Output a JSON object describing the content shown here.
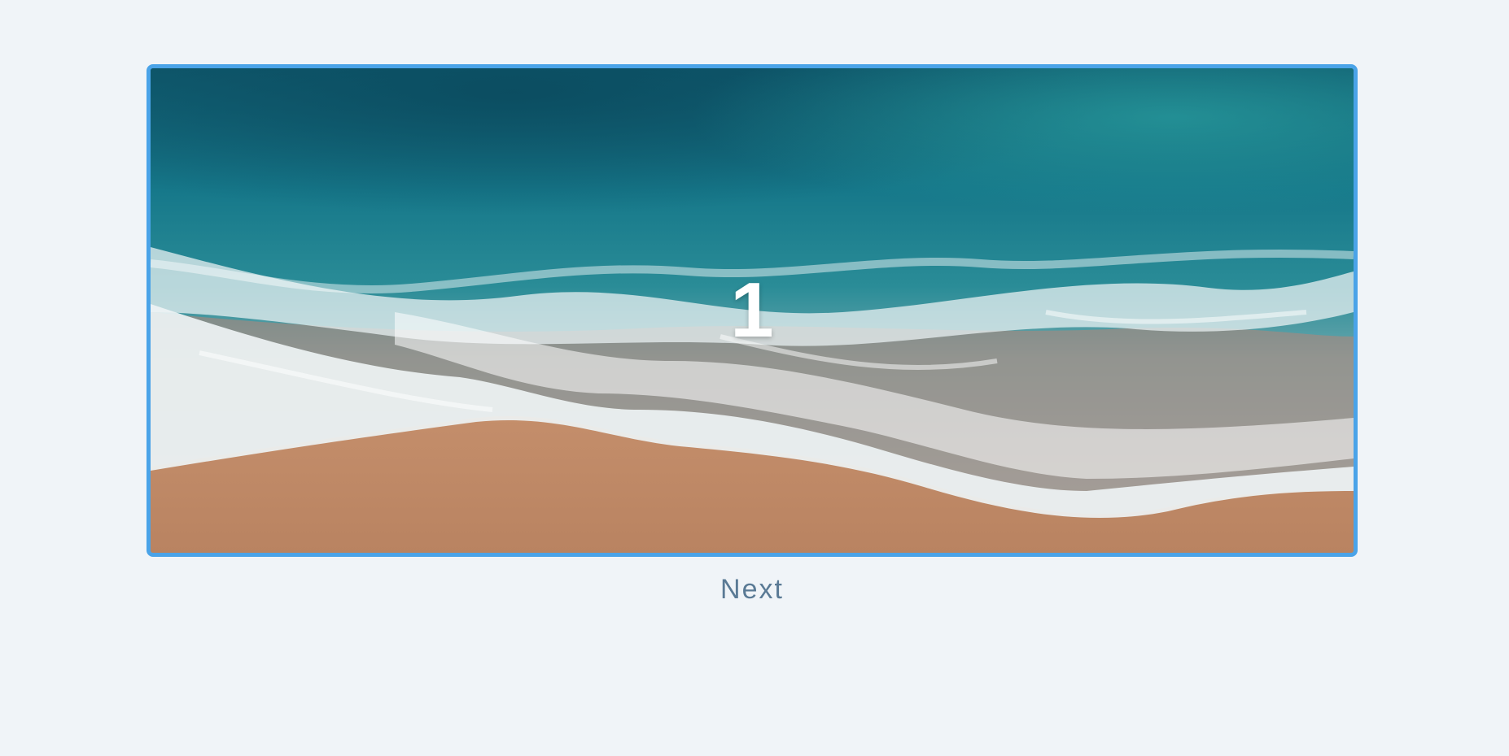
{
  "slideshow": {
    "current_slide_number": "1",
    "slide_image_subject": "beach-waves-aerial-photo",
    "frame_border_color": "#4aa3e8",
    "next_label": "Next"
  },
  "colors": {
    "background": "#f0f4f8",
    "accent": "#4aa3e8",
    "next_text": "#5a7a95"
  }
}
